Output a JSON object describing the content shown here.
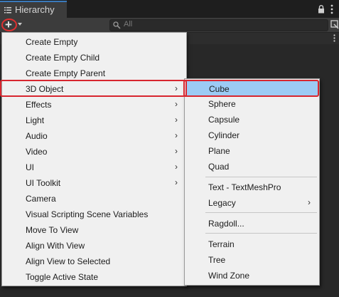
{
  "window": {
    "tab_title": "Hierarchy",
    "search_placeholder": "All"
  },
  "main_menu": {
    "items": [
      {
        "label": "Create Empty",
        "submenu": false
      },
      {
        "label": "Create Empty Child",
        "submenu": false
      },
      {
        "label": "Create Empty Parent",
        "submenu": false
      },
      {
        "label": "3D Object",
        "submenu": true,
        "highlighted": true
      },
      {
        "label": "Effects",
        "submenu": true
      },
      {
        "label": "Light",
        "submenu": true
      },
      {
        "label": "Audio",
        "submenu": true
      },
      {
        "label": "Video",
        "submenu": true
      },
      {
        "label": "UI",
        "submenu": true
      },
      {
        "label": "UI Toolkit",
        "submenu": true
      },
      {
        "label": "Camera",
        "submenu": false
      },
      {
        "label": "Visual Scripting Scene Variables",
        "submenu": false
      },
      {
        "label": "Move To View",
        "submenu": false
      },
      {
        "label": "Align With View",
        "submenu": false
      },
      {
        "label": "Align View to Selected",
        "submenu": false
      },
      {
        "label": "Toggle Active State",
        "submenu": false
      }
    ]
  },
  "sub_menu": {
    "items": [
      {
        "label": "Cube",
        "selected": true
      },
      {
        "label": "Sphere"
      },
      {
        "label": "Capsule"
      },
      {
        "label": "Cylinder"
      },
      {
        "label": "Plane"
      },
      {
        "label": "Quad"
      },
      {
        "label": "Text - TextMeshPro"
      },
      {
        "label": "Legacy",
        "submenu": true
      },
      {
        "label": "Ragdoll..."
      },
      {
        "label": "Terrain"
      },
      {
        "label": "Tree"
      },
      {
        "label": "Wind Zone"
      }
    ]
  },
  "colors": {
    "annotation_red": "#d8262f",
    "selection_blue": "#9ccbf4"
  },
  "icons": [
    "hierarchy-list-icon",
    "lock-icon",
    "kebab-menu-icon",
    "plus-icon",
    "search-icon",
    "scene-visibility-icon",
    "submenu-arrow-icon"
  ]
}
